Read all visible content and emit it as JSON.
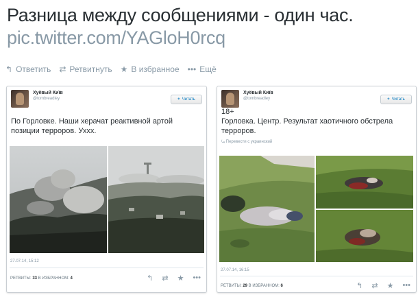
{
  "headline": {
    "title": "Разница между сообщениями - один час.",
    "link": "pic.twitter.com/YAGloH0rcq"
  },
  "actions": [
    {
      "icon": "reply-icon",
      "glyph": "↰",
      "label": "Ответить"
    },
    {
      "icon": "retweet-icon",
      "glyph": "⇄",
      "label": "Ретвитнуть"
    },
    {
      "icon": "star-icon",
      "glyph": "★",
      "label": "В избранное"
    },
    {
      "icon": "more-icon",
      "glyph": "•••",
      "label": "Ещё"
    }
  ],
  "tweets": [
    {
      "user": "Хуёвый Київ",
      "handle": "@tombreadley",
      "follow_label": "Читать",
      "text": "По Горловке. Наши херачат реактивной артой позиции терроров. Уххх.",
      "date": "27.07.14, 15:12",
      "retweets_label": "РЕТВИТЫ:",
      "retweets": "33",
      "favorites_label": "В ИЗБРАННОМ:",
      "favorites": "4"
    },
    {
      "user": "Хуёвый Київ",
      "handle": "@tombreadley",
      "follow_label": "Читать",
      "text": "18+\nГорловка. Центр. Результат хаотичного обстрела терроров.",
      "translate": "Перевести с украинский",
      "date": "27.07.14, 16:15",
      "retweets_label": "РЕТВИТЫ:",
      "retweets": "29",
      "favorites_label": "В ИЗБРАННОМ:",
      "favorites": "6"
    }
  ],
  "tweet_actions": {
    "reply": "↰",
    "retweet": "⇄",
    "favorite": "★",
    "more": "•••"
  },
  "colors": {
    "text": "#292f33",
    "muted": "#8899a6",
    "link_blue": "#0a7bbf",
    "border": "#c9ced3"
  }
}
